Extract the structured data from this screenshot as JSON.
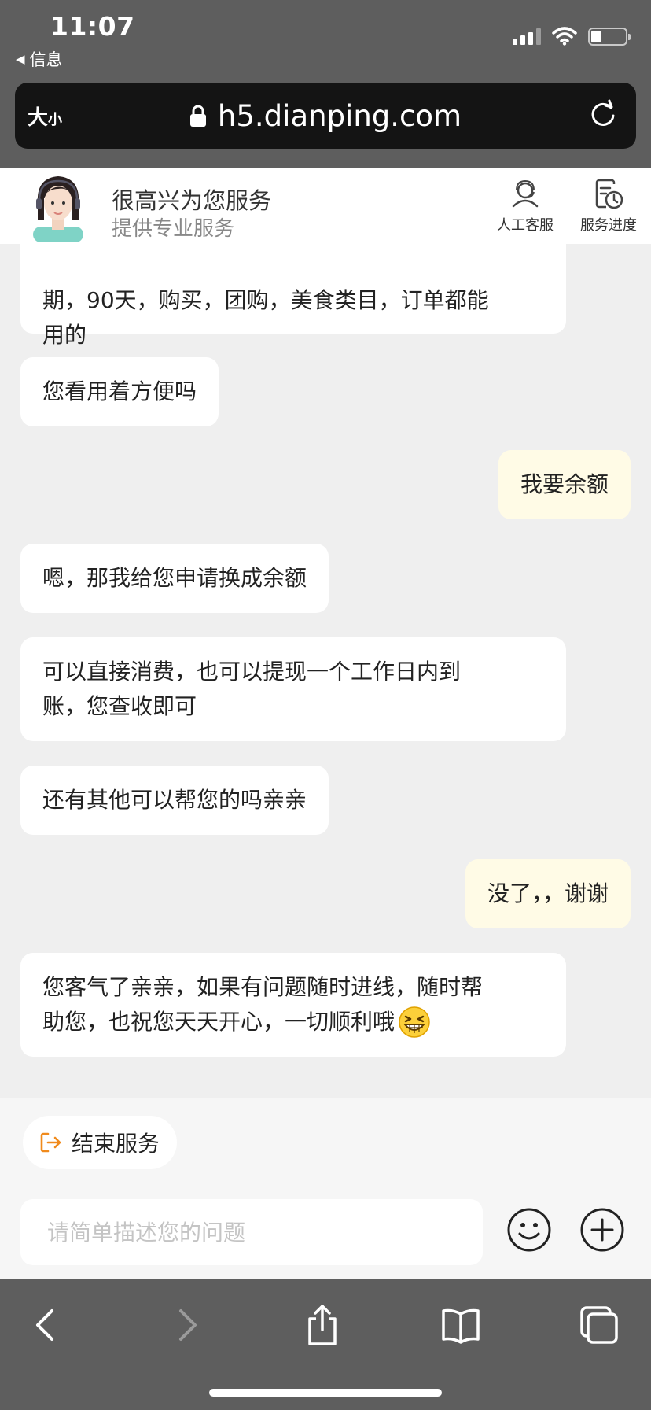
{
  "status_bar": {
    "time": "11:07",
    "back_app": "信息"
  },
  "browser": {
    "text_size_large": "大",
    "text_size_small": "小",
    "url": "h5.dianping.com"
  },
  "service_header": {
    "title": "很高兴为您服务",
    "subtitle": "提供专业服务",
    "actions": [
      {
        "label": "人工客服",
        "icon": "headset-agent-icon"
      },
      {
        "label": "服务进度",
        "icon": "progress-clock-icon"
      }
    ]
  },
  "messages": [
    {
      "from": "agent",
      "lines": [
        "期，90天，购买，团购，美食类目，订单都能",
        "用的"
      ]
    },
    {
      "from": "agent",
      "lines": [
        "您看用着方便吗"
      ]
    },
    {
      "from": "user",
      "lines": [
        "我要余额"
      ]
    },
    {
      "from": "agent",
      "lines": [
        "嗯，那我给您申请换成余额"
      ]
    },
    {
      "from": "agent",
      "lines": [
        "可以直接消费，也可以提现一个工作日内到",
        "账，您查收即可"
      ]
    },
    {
      "from": "agent",
      "lines": [
        "还有其他可以帮您的吗亲亲"
      ]
    },
    {
      "from": "user",
      "lines": [
        "没了，，谢谢"
      ]
    },
    {
      "from": "agent",
      "lines": [
        "您客气了亲亲，如果有问题随时进线，随时帮",
        "助您，也祝您天天开心，一切顺利哦"
      ],
      "emoji": "grinning-squint-emoji"
    }
  ],
  "bottom": {
    "end_service": "结束服务",
    "input_placeholder": "请简单描述您的问题",
    "input_value": ""
  },
  "colors": {
    "chrome_gray": "#5e5e5e",
    "url_bar": "#141414",
    "chat_bg": "#efefef",
    "agent_bubble": "#ffffff",
    "user_bubble": "#fffbe6",
    "accent_orange": "#f08a1c"
  }
}
